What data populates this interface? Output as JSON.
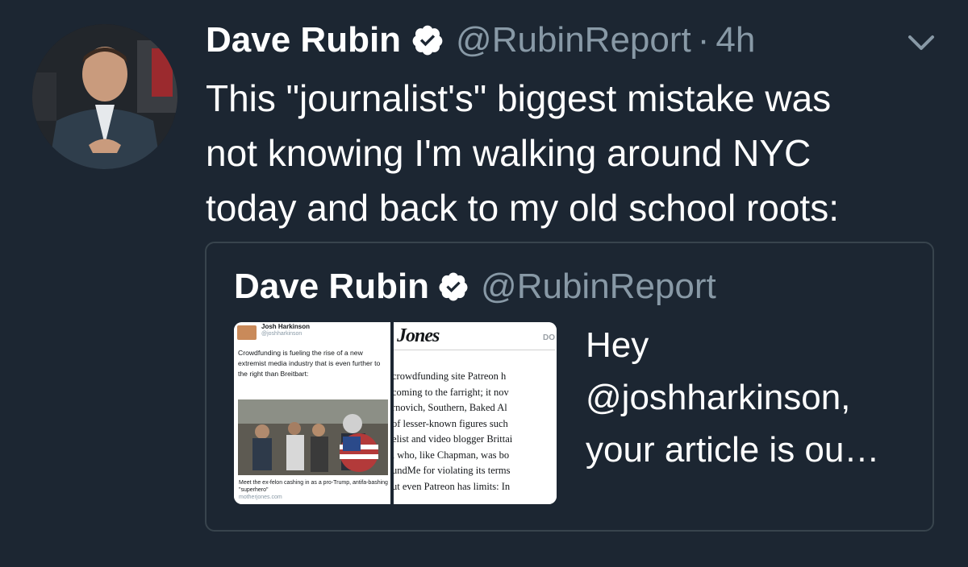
{
  "tweet": {
    "author_name": "Dave Rubin",
    "handle": "@RubinReport",
    "separator": "·",
    "time": "4h",
    "text": "This \"journalist's\" biggest mistake was\nnot knowing I'm walking around NYC\ntoday and back to my old school roots:",
    "icons": {
      "verified": "verified-badge-icon",
      "more": "chevron-down-icon"
    }
  },
  "quoted_tweet": {
    "author_name": "Dave Rubin",
    "handle": "@RubinReport",
    "text": "Hey\n@joshharkinson,\nyour article is ou…",
    "media": {
      "left_panel": {
        "author_name": "Josh Harkinson",
        "handle": "@joshharkinson",
        "text": "Crowdfunding is fueling the rise of a new extremist media industry that is even further to the right than Breitbart:",
        "caption": "Meet the ex-felon cashing in as a pro-Trump, antifa-bashing \"superhero\"",
        "domain": "motherjones.com"
      },
      "right_panel": {
        "brand": "Jones",
        "corner": "DO",
        "lines": [
          "crowdfunding site Patreon h",
          "coming to the farright; it nov",
          "rnovich, Southern, Baked Al",
          "of lesser-known figures such",
          "elist and video blogger Brittai",
          ", who, like Chapman, was bo",
          "undMe for violating its terms",
          "ut even Patreon has limits: In"
        ]
      }
    }
  },
  "colors": {
    "background": "#1c2632",
    "text": "#ffffff",
    "muted": "#8899a6",
    "border": "#38444d",
    "verified": "#ffffff"
  }
}
